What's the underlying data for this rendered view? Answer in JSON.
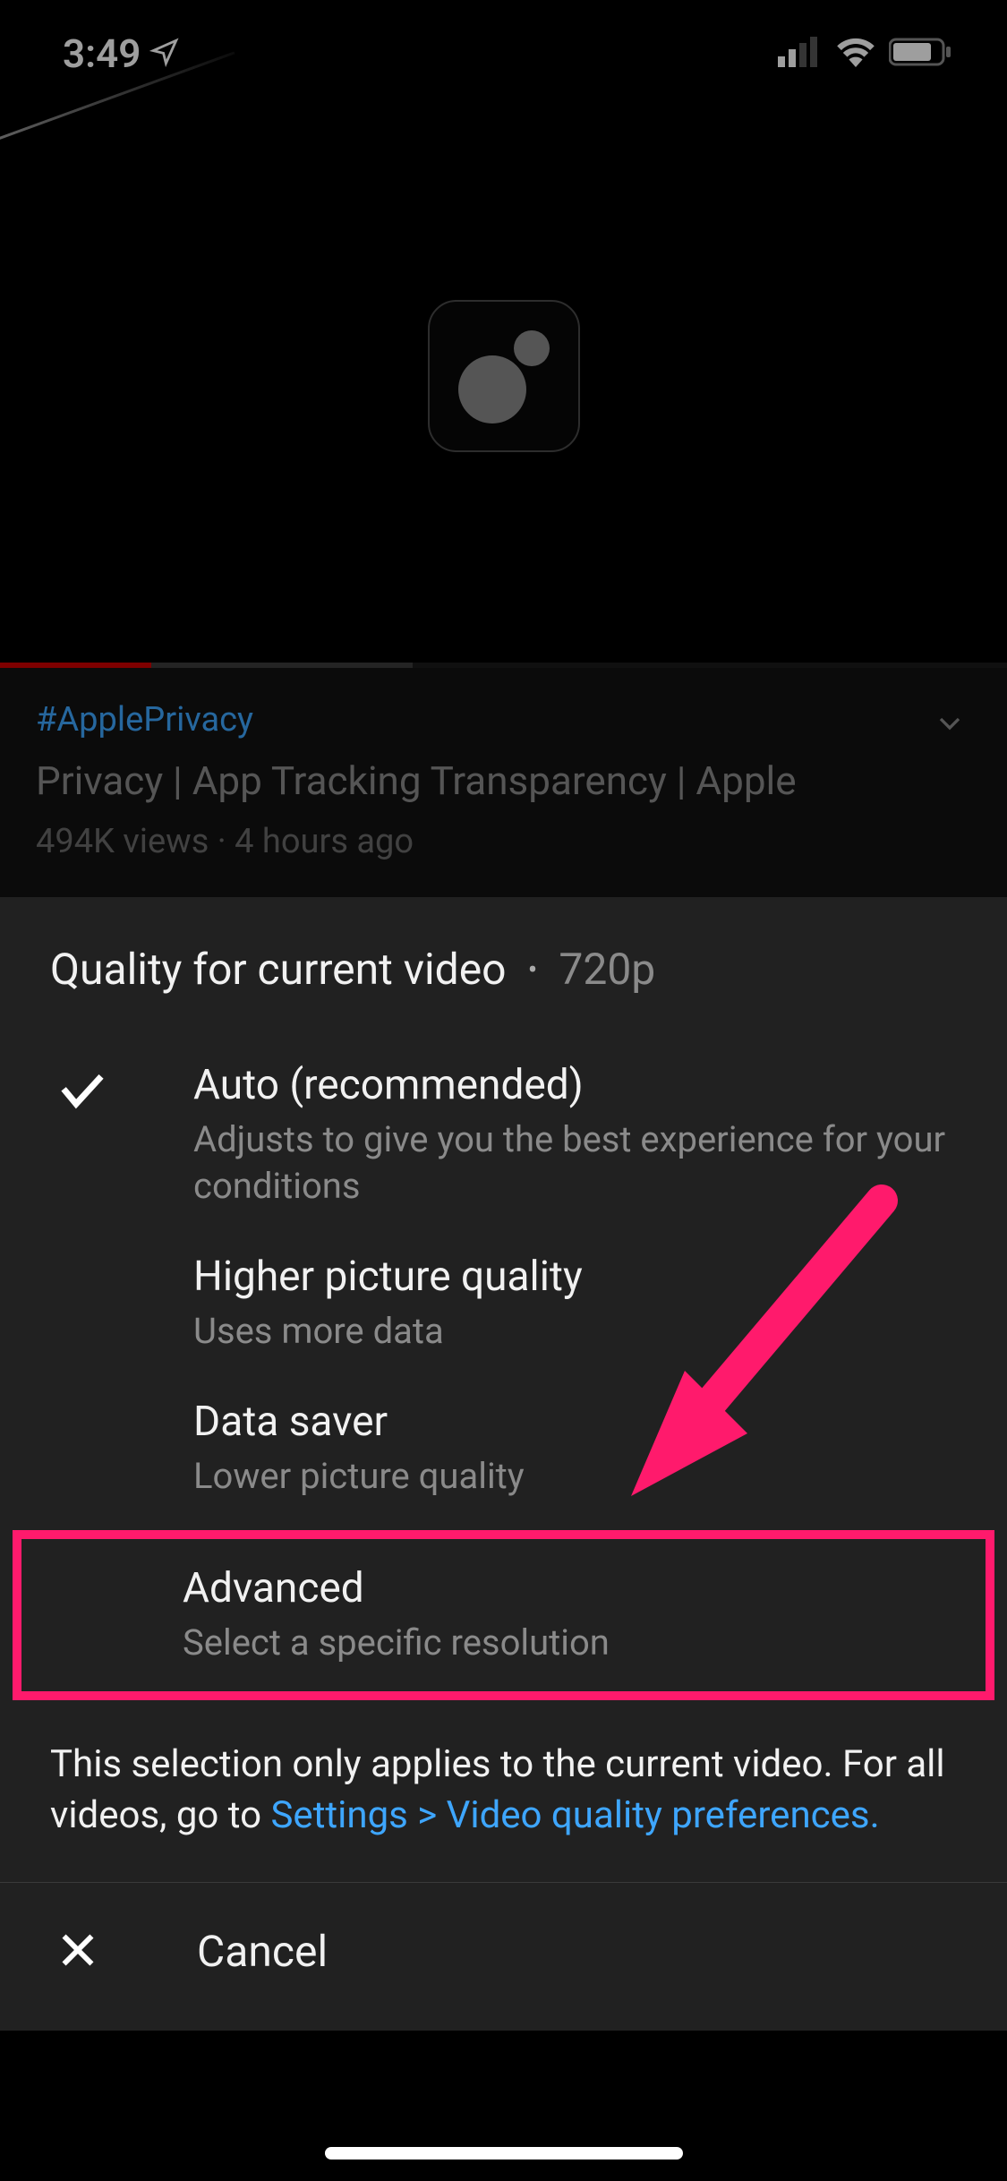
{
  "status": {
    "time": "3:49"
  },
  "video": {
    "hashtag": "#ApplePrivacy",
    "title": "Privacy | App Tracking Transparency | Apple",
    "views": "494K views",
    "age": "4 hours ago"
  },
  "sheet": {
    "title": "Quality for current video",
    "current_quality": "720p",
    "options": [
      {
        "title": "Auto (recommended)",
        "sub": "Adjusts to give you the best experience for your conditions",
        "selected": true
      },
      {
        "title": "Higher picture quality",
        "sub": "Uses more data",
        "selected": false
      },
      {
        "title": "Data saver",
        "sub": "Lower picture quality",
        "selected": false
      },
      {
        "title": "Advanced",
        "sub": "Select a specific resolution",
        "selected": false
      }
    ],
    "disclaimer_prefix": "This selection only applies to the current video. For all videos, go to ",
    "disclaimer_link": "Settings > Video quality preferences.",
    "cancel_label": "Cancel"
  },
  "annotation": {
    "highlight_color": "#ff1a6c"
  }
}
